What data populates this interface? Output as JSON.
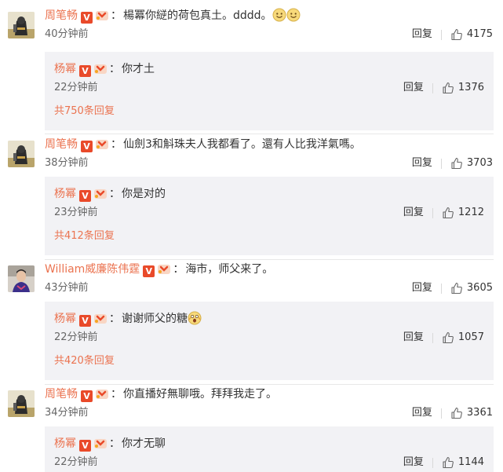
{
  "colors": {
    "username": "#eb7350",
    "reply_bg": "#f2f2f5",
    "vip": "#e94a2a"
  },
  "comments": [
    {
      "user": "周笔畅",
      "text": "楊冪你縌的荷包真土。dddd。",
      "emojis": [
        "smile-emoji",
        "smile-emoji"
      ],
      "time": "40分钟前",
      "reply_label": "回复",
      "likes": "4175",
      "reply": {
        "user": "杨幂",
        "text": "你才土",
        "time": "22分钟前",
        "reply_label": "回复",
        "likes": "1376"
      },
      "more": "共750条回复"
    },
    {
      "user": "周笔畅",
      "text": "仙劍3和斛珠夫人我都看了。還有人比我洋氣嗎。",
      "emojis": [],
      "time": "38分钟前",
      "reply_label": "回复",
      "likes": "3703",
      "reply": {
        "user": "杨幂",
        "text": "你是对的",
        "time": "23分钟前",
        "reply_label": "回复",
        "likes": "1212"
      },
      "more": "共412条回复"
    },
    {
      "user": "William威廉陈伟霆",
      "text": "海市，师父来了。",
      "emojis": [],
      "time": "43分钟前",
      "reply_label": "回复",
      "likes": "3605",
      "reply": {
        "user": "杨幂",
        "text": "谢谢师父的糖",
        "emoji": "shocked-emoji",
        "time": "22分钟前",
        "reply_label": "回复",
        "likes": "1057"
      },
      "more": "共420条回复"
    },
    {
      "user": "周笔畅",
      "text": "你直播好無聊哦。拜拜我走了。",
      "emojis": [],
      "time": "34分钟前",
      "reply_label": "回复",
      "likes": "3361",
      "reply": {
        "user": "杨幂",
        "text": "你才无聊",
        "time": "22分钟前",
        "reply_label": "回复",
        "likes": "1144"
      }
    }
  ],
  "badge": {
    "v": "V"
  },
  "separator": "："
}
